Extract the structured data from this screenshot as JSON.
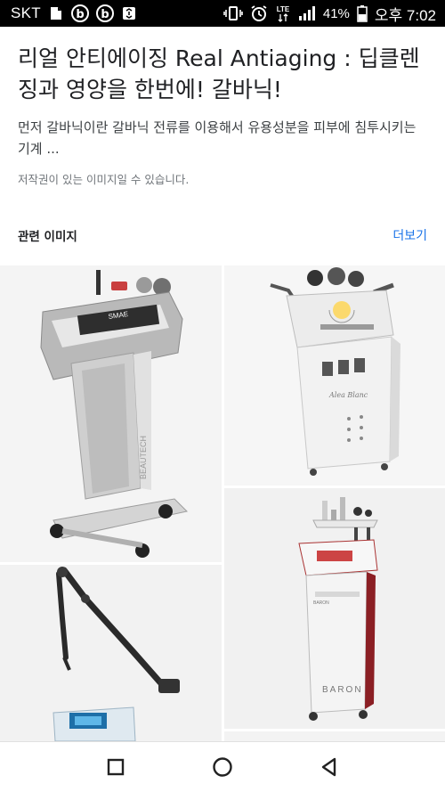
{
  "status_bar": {
    "carrier": "SKT",
    "battery": "41%",
    "time": "오후 7:02",
    "network": "LTE",
    "icons": [
      "file-icon",
      "b-app-icon",
      "b-app-icon",
      "recycle-icon",
      "vibrate-icon",
      "alarm-icon",
      "signal-icon",
      "battery-icon"
    ]
  },
  "result": {
    "title": "리얼 안티에이징 Real Antiaging : 딥클렌징과 영양을 한번에! 갈바닉!",
    "snippet": "먼저 갈바닉이란 갈바닉 전류를 이용해서 유용성분을 피부에 침투시키는 기계 ...",
    "copyright": "저작권이 있는 이미지일 수 있습니다."
  },
  "related": {
    "title": "관련 이미지",
    "more": "더보기"
  },
  "images": {
    "img1_brand": "SMAE",
    "img1_side": "BEAUTECH",
    "img4_brand": "BARON",
    "img4_label": "BARON"
  },
  "navbar": {
    "icons": [
      "recent-apps-icon",
      "home-icon",
      "back-icon"
    ]
  }
}
